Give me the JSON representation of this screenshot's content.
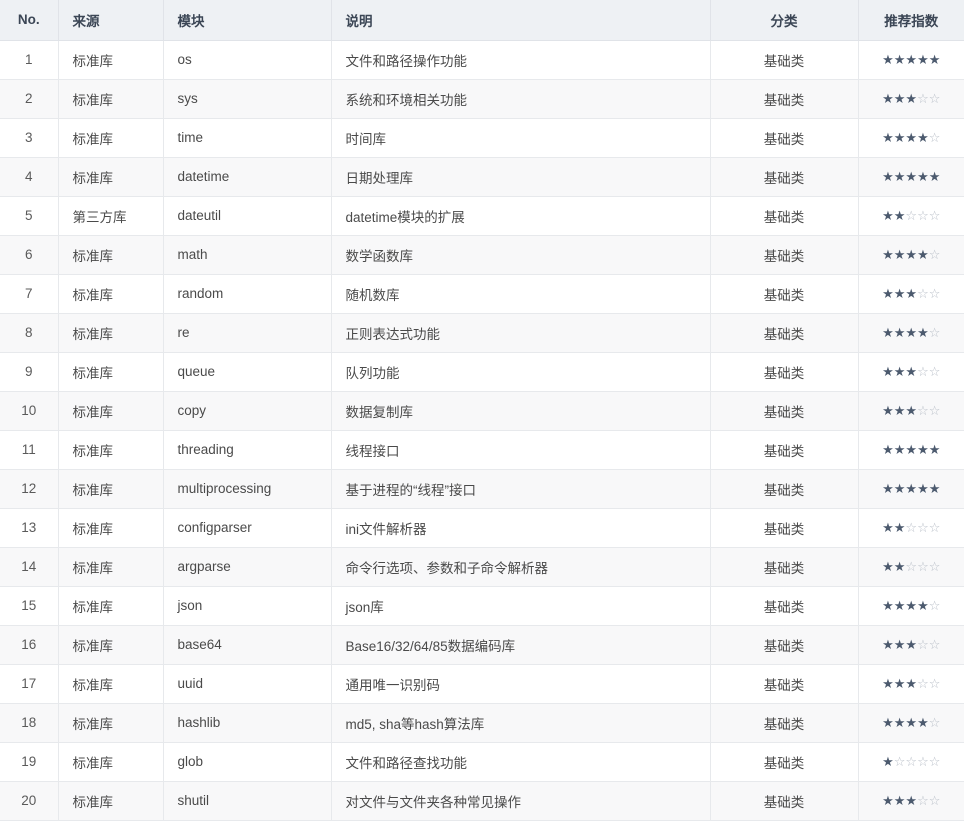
{
  "table": {
    "columns": [
      {
        "key": "no",
        "label": "No.",
        "align": "center"
      },
      {
        "key": "source",
        "label": "来源",
        "align": "left"
      },
      {
        "key": "module",
        "label": "模块",
        "align": "left"
      },
      {
        "key": "desc",
        "label": "说明",
        "align": "left"
      },
      {
        "key": "cat",
        "label": "分类",
        "align": "center"
      },
      {
        "key": "stars",
        "label": "推荐指数",
        "align": "center"
      }
    ],
    "max_stars": 5,
    "star_on_glyph": "★",
    "star_off_glyph": "☆",
    "colors": {
      "header_bg": "#eef1f4",
      "header_text": "#3b4655",
      "row_alt_bg": "#f8f8f9",
      "row_bg": "#ffffff",
      "border": "#e7e9ec",
      "body_text": "#4a4a4a",
      "star_on": "#4c5a6e",
      "star_off": "#b9bfc8"
    },
    "rows": [
      {
        "no": "1",
        "source": "标准库",
        "module": "os",
        "desc": "文件和路径操作功能",
        "cat": "基础类",
        "stars": 5
      },
      {
        "no": "2",
        "source": "标准库",
        "module": "sys",
        "desc": "系统和环境相关功能",
        "cat": "基础类",
        "stars": 3
      },
      {
        "no": "3",
        "source": "标准库",
        "module": "time",
        "desc": "时间库",
        "cat": "基础类",
        "stars": 4
      },
      {
        "no": "4",
        "source": "标准库",
        "module": "datetime",
        "desc": "日期处理库",
        "cat": "基础类",
        "stars": 5
      },
      {
        "no": "5",
        "source": "第三方库",
        "module": "dateutil",
        "desc": "datetime模块的扩展",
        "cat": "基础类",
        "stars": 2
      },
      {
        "no": "6",
        "source": "标准库",
        "module": "math",
        "desc": "数学函数库",
        "cat": "基础类",
        "stars": 4
      },
      {
        "no": "7",
        "source": "标准库",
        "module": "random",
        "desc": "随机数库",
        "cat": "基础类",
        "stars": 3
      },
      {
        "no": "8",
        "source": "标准库",
        "module": "re",
        "desc": "正则表达式功能",
        "cat": "基础类",
        "stars": 4
      },
      {
        "no": "9",
        "source": "标准库",
        "module": "queue",
        "desc": "队列功能",
        "cat": "基础类",
        "stars": 3
      },
      {
        "no": "10",
        "source": "标准库",
        "module": "copy",
        "desc": "数据复制库",
        "cat": "基础类",
        "stars": 3
      },
      {
        "no": "11",
        "source": "标准库",
        "module": "threading",
        "desc": "线程接口",
        "cat": "基础类",
        "stars": 5
      },
      {
        "no": "12",
        "source": "标准库",
        "module": "multiprocessing",
        "desc": "基于进程的“线程”接口",
        "cat": "基础类",
        "stars": 5
      },
      {
        "no": "13",
        "source": "标准库",
        "module": "configparser",
        "desc": "ini文件解析器",
        "cat": "基础类",
        "stars": 2
      },
      {
        "no": "14",
        "source": "标准库",
        "module": "argparse",
        "desc": "命令行选项、参数和子命令解析器",
        "cat": "基础类",
        "stars": 2
      },
      {
        "no": "15",
        "source": "标准库",
        "module": "json",
        "desc": "json库",
        "cat": "基础类",
        "stars": 4
      },
      {
        "no": "16",
        "source": "标准库",
        "module": "base64",
        "desc": "Base16/32/64/85数据编码库",
        "cat": "基础类",
        "stars": 3
      },
      {
        "no": "17",
        "source": "标准库",
        "module": "uuid",
        "desc": "通用唯一识别码",
        "cat": "基础类",
        "stars": 3
      },
      {
        "no": "18",
        "source": "标准库",
        "module": "hashlib",
        "desc": "md5, sha等hash算法库",
        "cat": "基础类",
        "stars": 4
      },
      {
        "no": "19",
        "source": "标准库",
        "module": "glob",
        "desc": "文件和路径查找功能",
        "cat": "基础类",
        "stars": 1
      },
      {
        "no": "20",
        "source": "标准库",
        "module": "shutil",
        "desc": "对文件与文件夹各种常见操作",
        "cat": "基础类",
        "stars": 3
      }
    ]
  }
}
